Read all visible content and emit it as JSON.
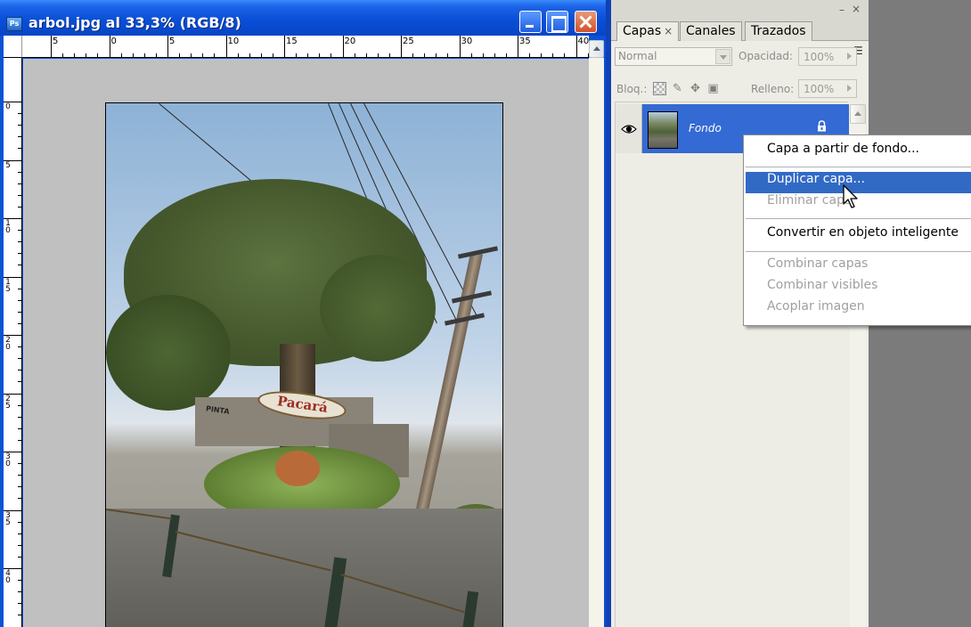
{
  "document": {
    "app_icon": "Ps",
    "title": "arbol.jpg al 33,3% (RGB/8)",
    "h_ruler_labels": [
      "5",
      "0",
      "5",
      "10",
      "15",
      "20",
      "25",
      "30",
      "35",
      "40"
    ],
    "v_ruler_labels": [
      "0",
      "5",
      "10",
      "15",
      "20",
      "25",
      "30",
      "35",
      "40"
    ],
    "photo_signs": {
      "sign_main": "Pacará",
      "sign_left": "PINTA"
    }
  },
  "layers_panel": {
    "tabs": [
      {
        "label": "Capas",
        "close": "×"
      },
      {
        "label": "Canales"
      },
      {
        "label": "Trazados"
      }
    ],
    "panel_minimize": "–",
    "panel_close": "×",
    "panel_menu": "▾☰",
    "blend_mode": "Normal",
    "opacity_label": "Opacidad:",
    "opacity_value": "100%",
    "lock_label": "Bloq.:",
    "fill_label": "Relleno:",
    "fill_value": "100%",
    "layers": [
      {
        "name": "Fondo",
        "visible": true,
        "locked": true
      }
    ]
  },
  "context_menu": {
    "items": [
      {
        "label": "Capa a partir de fondo...",
        "enabled": true
      },
      {
        "label": "Duplicar capa...",
        "enabled": true,
        "highlighted": true
      },
      {
        "label": "Eliminar capa",
        "enabled": false
      },
      {
        "label": "Convertir en objeto inteligente",
        "enabled": true
      },
      {
        "label": "Combinar capas",
        "enabled": false
      },
      {
        "label": "Combinar visibles",
        "enabled": false
      },
      {
        "label": "Acoplar imagen",
        "enabled": false
      }
    ]
  },
  "colors": {
    "titlebar_blue": "#0a4fd8",
    "menu_highlight": "#316ac5",
    "layer_selected": "#346ad3",
    "workspace_gray": "#7b7b7b",
    "canvas_gray": "#c0c0c0"
  }
}
